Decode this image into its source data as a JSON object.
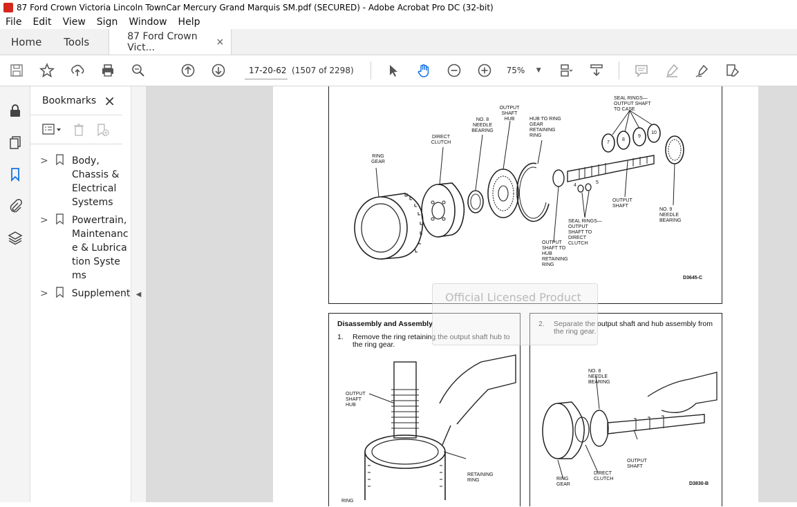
{
  "window": {
    "title": "87 Ford Crown Victoria Lincoln TownCar Mercury Grand Marquis SM.pdf (SECURED) - Adobe Acrobat Pro DC (32-bit)"
  },
  "menu": [
    "File",
    "Edit",
    "View",
    "Sign",
    "Window",
    "Help"
  ],
  "tabs": {
    "home": "Home",
    "tools": "Tools",
    "doc": "87 Ford Crown Vict...",
    "close": "×"
  },
  "toolbar": {
    "page_value": "17-20-62",
    "page_count": "(1507 of 2298)",
    "zoom": "75%"
  },
  "bookmarks": {
    "title": "Bookmarks",
    "close": "×",
    "items": [
      {
        "label": "Body, Chassis & Electrical Systems"
      },
      {
        "label": "Powertrain, Maintenance & Lubrication Systems"
      },
      {
        "label": "Supplement"
      }
    ]
  },
  "document": {
    "top_figure": {
      "code": "D3645-C",
      "labels": {
        "ring_gear": "RING GEAR",
        "direct_clutch": "DIRECT CLUTCH",
        "needle8": "NO. 8 NEEDLE BEARING",
        "hub": "OUTPUT SHAFT HUB",
        "hub_ring": "HUB TO RING GEAR RETAINING RING",
        "seal_case": "SEAL RINGS— OUTPUT SHAFT TO CASE",
        "output_shaft": "OUTPUT SHAFT",
        "needle9": "NO. 9 NEEDLE BEARING",
        "seal_clutch": "SEAL RINGS— OUTPUT SHAFT TO DIRECT CLUTCH",
        "shaft_ring": "OUTPUT SHAFT TO HUB RETAINING RING",
        "n4": "4",
        "n5": "5",
        "n7": "7",
        "n8": "8",
        "n9": "9",
        "n10": "10"
      }
    },
    "section_heading": "Disassembly and Assembly",
    "step1": {
      "num": "1.",
      "text": "Remove the ring retaining the output shaft hub to the ring gear."
    },
    "step2": {
      "num": "2.",
      "text": "Separate the output shaft and hub assembly from the ring gear."
    },
    "left_figure": {
      "hub": "OUTPUT SHAFT HUB",
      "ring": "RETAINING RING",
      "ring_gear": "RING"
    },
    "right_figure": {
      "code": "D3830-B",
      "needle8": "NO. 8 NEEDLE BEARING",
      "output_shaft": "OUTPUT SHAFT",
      "direct_clutch": "DIRECT CLUTCH",
      "ring_gear": "RING GEAR"
    },
    "watermark": "Official Licensed Product"
  }
}
